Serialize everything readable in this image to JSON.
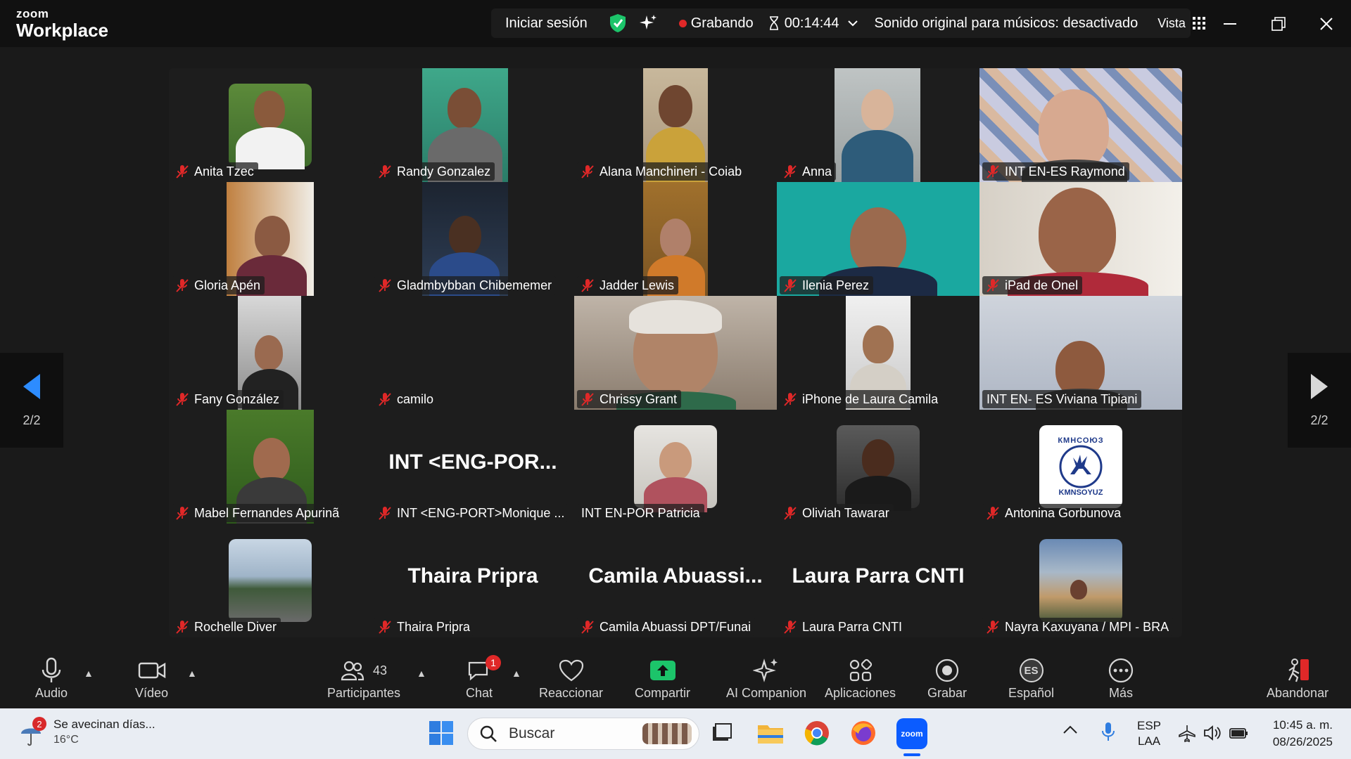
{
  "app": {
    "logo_small": "zoom",
    "logo_big": "Workplace"
  },
  "topbar": {
    "sign_in": "Iniciar sesión",
    "recording": "Grabando",
    "timer": "00:14:44",
    "sound": "Sonido original para músicos: desactivado",
    "view": "Vista"
  },
  "pager": {
    "left": "2/2",
    "right": "2/2"
  },
  "participants": [
    {
      "name": "Anita Tzec"
    },
    {
      "name": "Randy Gonzalez"
    },
    {
      "name": "Alana Manchineri - Coiab"
    },
    {
      "name": "Anna"
    },
    {
      "name": "INT EN-ES Raymond"
    },
    {
      "name": "Gloria Apén"
    },
    {
      "name": "Gladmbybban Chibememer"
    },
    {
      "name": "Jadder Lewis"
    },
    {
      "name": "Ilenia Perez"
    },
    {
      "name": "iPad de Onel"
    },
    {
      "name": "Fany González"
    },
    {
      "name": "camilo"
    },
    {
      "name": "Chrissy Grant"
    },
    {
      "name": "iPhone de Laura Camila"
    },
    {
      "name": "INT EN- ES Viviana Tipiani"
    },
    {
      "name": "Mabel Fernandes Apurinã"
    },
    {
      "name": "INT <ENG-PORT>Monique ...",
      "big": "INT  <ENG-POR..."
    },
    {
      "name": "INT EN-POR Patricia"
    },
    {
      "name": "Oliviah Tawarar"
    },
    {
      "name": "Antonina Gorbunova",
      "logo_top": "КМНСОЮЗ",
      "logo_bottom": "KMNSOYUZ"
    },
    {
      "name": "Rochelle Diver"
    },
    {
      "name": "Thaira Pripra",
      "big": "Thaira Pripra"
    },
    {
      "name": "Camila Abuassi DPT/Funai",
      "big": "Camila  Abuassi..."
    },
    {
      "name": "Laura Parra CNTI",
      "big": "Laura Parra CNTI"
    },
    {
      "name": "Nayra Kaxuyana / MPI - BRA"
    }
  ],
  "toolbar": {
    "audio": "Audio",
    "video": "Vídeo",
    "participants": "Participantes",
    "participants_count": "43",
    "chat": "Chat",
    "chat_badge": "1",
    "react": "Reaccionar",
    "share": "Compartir",
    "ai": "AI Companion",
    "apps": "Aplicaciones",
    "record": "Grabar",
    "lang_code": "ES",
    "language": "Español",
    "more": "Más",
    "leave": "Abandonar"
  },
  "taskbar": {
    "weather_badge": "2",
    "weather_text": "Se avecinan días...",
    "weather_temp": "16°C",
    "search": "Buscar",
    "zoom_icon_text": "zoom",
    "lang1": "ESP",
    "lang2": "LAA",
    "time": "10:45 a. m.",
    "date": "08/26/2025"
  },
  "colors": {
    "accent_green": "#1cc46a",
    "record_red": "#e02828",
    "mic_red": "#e02828",
    "zoom_blue": "#0b5cff",
    "pager_blue": "#2d8cff"
  }
}
